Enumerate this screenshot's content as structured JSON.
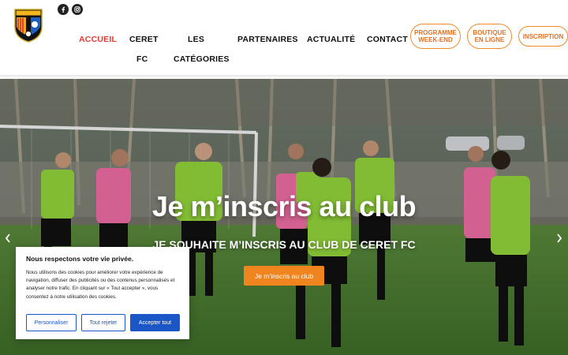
{
  "header": {
    "logo_text": "CERET FC",
    "social": [
      {
        "icon": "facebook-icon"
      },
      {
        "icon": "instagram-icon"
      }
    ],
    "nav": [
      {
        "label": "ACCUEIL",
        "active": true
      },
      {
        "label": "CERET",
        "line2": "FC"
      },
      {
        "label": "LES",
        "line2": "CATÉGORIES"
      },
      {
        "label": "PARTENAIRES"
      },
      {
        "label": "ACTUALITÉ"
      },
      {
        "label": "CONTACT"
      }
    ],
    "pills": [
      {
        "line1": "PROGRAMME",
        "line2": "WEEK-END"
      },
      {
        "line1": "BOUTIQUE",
        "line2": "EN LIGNE"
      },
      {
        "line1": "INSCRIPTION",
        "line2": ""
      }
    ],
    "accent": "#e53a2f",
    "pill_color": "#f08a2a"
  },
  "hero": {
    "title": "Je m’inscris au club",
    "subtitle": "JE SOUHAITE M’INSCRIS AU CLUB DE CERET FC",
    "button_label": "Je m’inscris au club",
    "prev_icon": "chevron-left-icon",
    "next_icon": "chevron-right-icon",
    "button_color": "#f0851f"
  },
  "cookie": {
    "title": "Nous respectons votre vie privée.",
    "text": "Nous utilisons des cookies pour améliorer votre expérience de navigation, diffuser des publicités ou des contenus personnalisés et analyser notre trafic. En cliquant sur « Tout accepter », vous consentez à notre utilisation des cookies.",
    "customize": "Personnaliser",
    "reject": "Tout rejeter",
    "accept": "Accepter tout",
    "button_color": "#1a56c5"
  }
}
